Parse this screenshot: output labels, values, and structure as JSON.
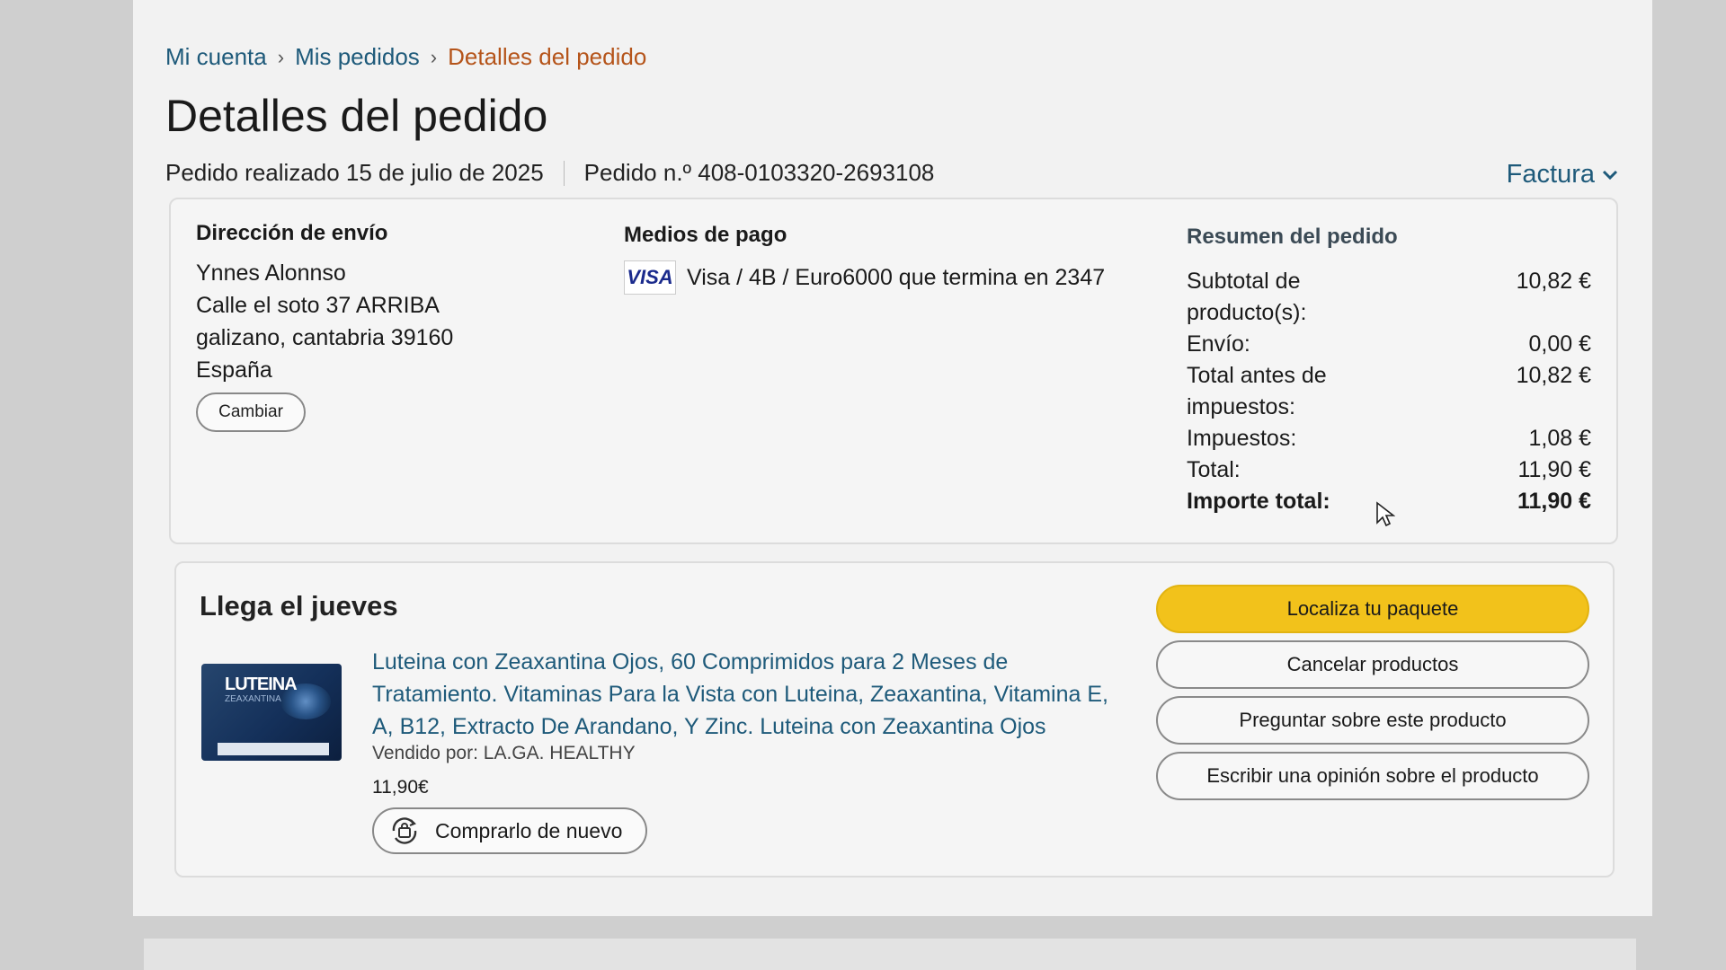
{
  "breadcrumb": {
    "items": [
      "Mi cuenta",
      "Mis pedidos"
    ],
    "current": "Detalles del pedido",
    "separator": "›"
  },
  "page_title": "Detalles del pedido",
  "order_meta": {
    "date_text": "Pedido realizado 15 de julio de 2025",
    "order_number_text": "Pedido n.º 408-0103320-2693108"
  },
  "invoice_label": "Factura",
  "shipping": {
    "heading": "Dirección de envío",
    "name": "Ynnes Alonnso",
    "street": "Calle el soto 37 ARRIBA",
    "city": "galizano, cantabria 39160",
    "country": "España",
    "change_label": "Cambiar"
  },
  "payment": {
    "heading": "Medios de pago",
    "card_logo": "VISA",
    "text": "Visa / 4B / Euro6000 que termina en 2347"
  },
  "summary": {
    "heading": "Resumen del pedido",
    "rows": [
      {
        "label": "Subtotal de producto(s):",
        "value": "10,82 €"
      },
      {
        "label": "Envío:",
        "value": "0,00 €"
      },
      {
        "label": "Total antes de impuestos:",
        "value": "10,82 €"
      },
      {
        "label": "Impuestos:",
        "value": "1,08 €"
      },
      {
        "label": "Total:",
        "value": "11,90 €"
      },
      {
        "label": "Importe total:",
        "value": "11,90 €"
      }
    ]
  },
  "shipment": {
    "arrival": "Llega el jueves",
    "product": {
      "image_text": "LUTEINA",
      "image_subtext": "ZEAXANTINA",
      "title": "Luteina con Zeaxantina Ojos, 60 Comprimidos para 2 Meses de Tratamiento. Vitaminas Para la Vista con Luteina, Zeaxantina, Vitamina E, A, B12, Extracto De Arandano, Y Zinc. Luteina con Zeaxantina Ojos",
      "seller": "Vendido por: LA.GA. HEALTHY",
      "price": "11,90€",
      "buy_again_label": "Comprarlo de nuevo"
    },
    "actions": [
      "Localiza tu paquete",
      "Cancelar productos",
      "Preguntar sobre este producto",
      "Escribir una opinión sobre el producto"
    ]
  },
  "colors": {
    "link": "#1e5a7a",
    "breadcrumb_current": "#b5541a",
    "primary_button": "#f2c21b"
  }
}
